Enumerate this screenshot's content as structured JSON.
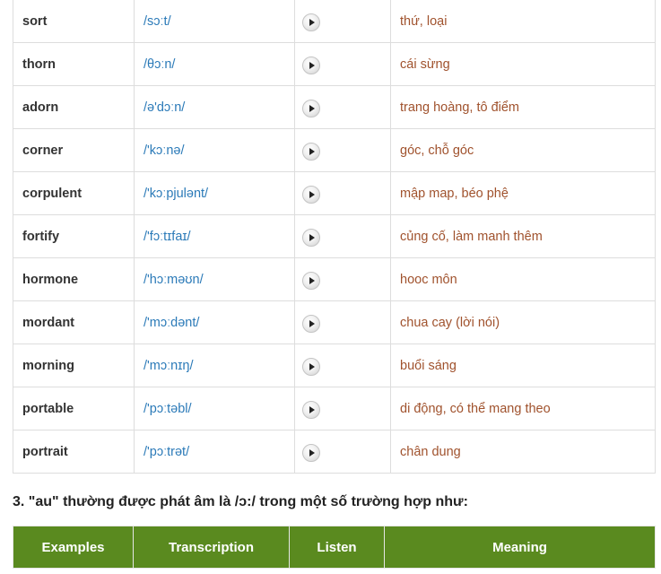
{
  "words": [
    {
      "word": "sort",
      "ipa": "/sɔːt/",
      "meaning": "thứ, loại"
    },
    {
      "word": "thorn",
      "ipa": "/θɔːn/",
      "meaning": "cái sừng"
    },
    {
      "word": "adorn",
      "ipa": "/ə'dɔːn/",
      "meaning": "trang hoàng, tô điểm"
    },
    {
      "word": "corner",
      "ipa": "/'kɔːnə/",
      "meaning": "góc, chỗ góc"
    },
    {
      "word": "corpulent",
      "ipa": "/'kɔːpjulənt/",
      "meaning": "mập map, béo phệ"
    },
    {
      "word": "fortify",
      "ipa": "/'fɔːtɪfaɪ/",
      "meaning": "củng cố, làm manh thêm"
    },
    {
      "word": "hormone",
      "ipa": "/'hɔːməʊn/",
      "meaning": "hooc môn"
    },
    {
      "word": "mordant",
      "ipa": "/'mɔːdənt/",
      "meaning": "chua cay (lời nói)"
    },
    {
      "word": "morning",
      "ipa": "/'mɔːnɪŋ/",
      "meaning": "buổi sáng"
    },
    {
      "word": "portable",
      "ipa": "/'pɔːtəbl/",
      "meaning": "di động, có thể mang theo"
    },
    {
      "word": "portrait",
      "ipa": "/'pɔːtrət/",
      "meaning": "chân dung"
    }
  ],
  "section_heading": "3. \"au\" thường được phát âm là /ɔ:/ trong một số trường hợp như:",
  "next_table_headers": {
    "examples": "Examples",
    "transcription": "Transcription",
    "listen": "Listen",
    "meaning": "Meaning"
  },
  "colors": {
    "header_bg": "#5a8a1f",
    "ipa": "#2b7ab8",
    "meaning": "#a0522d"
  },
  "icons": {
    "play": "play-icon"
  }
}
